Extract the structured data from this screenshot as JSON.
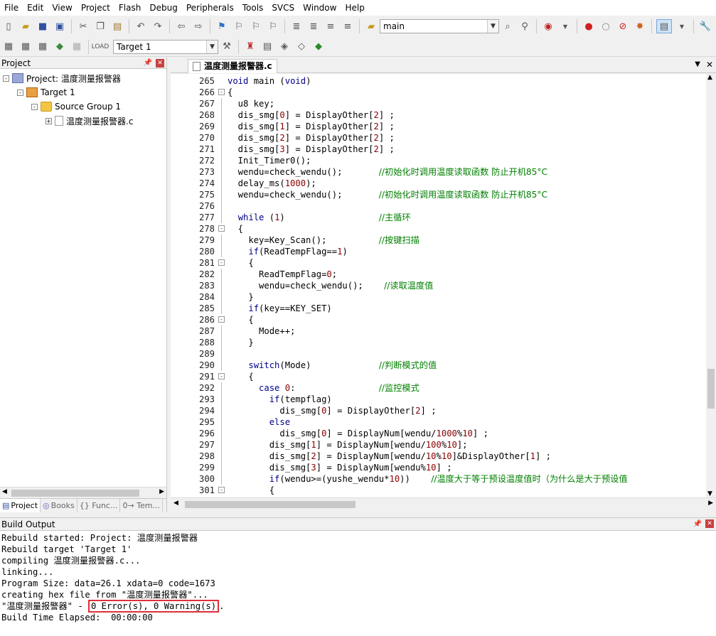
{
  "menu": [
    "File",
    "Edit",
    "View",
    "Project",
    "Flash",
    "Debug",
    "Peripherals",
    "Tools",
    "SVCS",
    "Window",
    "Help"
  ],
  "toolbar": {
    "find_combo_value": "main",
    "target_combo_value": "Target 1"
  },
  "project_panel": {
    "title": "Project",
    "tree": [
      {
        "label": "Project: 温度测量报警器",
        "toggle": "-"
      },
      {
        "label": "Target 1",
        "toggle": "-"
      },
      {
        "label": "Source Group 1",
        "toggle": "-"
      },
      {
        "label": "温度测量报警器.c",
        "toggle": "+"
      }
    ],
    "tabs": [
      "Project",
      "Books",
      "{} Func...",
      "0→ Tem..."
    ]
  },
  "editor": {
    "tab_label": "温度测量报警器.c",
    "lines": [
      {
        "n": "265",
        "fold": "",
        "code": "void main (void)"
      },
      {
        "n": "266",
        "fold": "-",
        "code": "{"
      },
      {
        "n": "267",
        "fold": "|",
        "code": "  u8 key;"
      },
      {
        "n": "268",
        "fold": "|",
        "code": "  dis_smg[0] = DisplayOther[2] ;"
      },
      {
        "n": "269",
        "fold": "|",
        "code": "  dis_smg[1] = DisplayOther[2] ;"
      },
      {
        "n": "270",
        "fold": "|",
        "code": "  dis_smg[2] = DisplayOther[2] ;"
      },
      {
        "n": "271",
        "fold": "|",
        "code": "  dis_smg[3] = DisplayOther[2] ;"
      },
      {
        "n": "272",
        "fold": "|",
        "code": "  Init_Timer0();"
      },
      {
        "n": "273",
        "fold": "|",
        "code": "  wendu=check_wendu();       //初始化时调用温度读取函数 防止开机85°C"
      },
      {
        "n": "274",
        "fold": "|",
        "code": "  delay_ms(1000);"
      },
      {
        "n": "275",
        "fold": "|",
        "code": "  wendu=check_wendu();       //初始化时调用温度读取函数 防止开机85°C"
      },
      {
        "n": "276",
        "fold": "|",
        "code": ""
      },
      {
        "n": "277",
        "fold": "|",
        "code": "  while (1)                  //主循环"
      },
      {
        "n": "278",
        "fold": "-",
        "code": "  {"
      },
      {
        "n": "279",
        "fold": "|",
        "code": "    key=Key_Scan();          //按键扫描"
      },
      {
        "n": "280",
        "fold": "|",
        "code": "    if(ReadTempFlag==1)"
      },
      {
        "n": "281",
        "fold": "-",
        "code": "    {"
      },
      {
        "n": "282",
        "fold": "|",
        "code": "      ReadTempFlag=0;"
      },
      {
        "n": "283",
        "fold": "|",
        "code": "      wendu=check_wendu();    //读取温度值"
      },
      {
        "n": "284",
        "fold": "|",
        "code": "    }"
      },
      {
        "n": "285",
        "fold": "|",
        "code": "    if(key==KEY_SET)"
      },
      {
        "n": "286",
        "fold": "-",
        "code": "    {"
      },
      {
        "n": "287",
        "fold": "|",
        "code": "      Mode++;"
      },
      {
        "n": "288",
        "fold": "|",
        "code": "    }"
      },
      {
        "n": "289",
        "fold": "|",
        "code": ""
      },
      {
        "n": "290",
        "fold": "|",
        "code": "    switch(Mode)             //判断模式的值"
      },
      {
        "n": "291",
        "fold": "-",
        "code": "    {"
      },
      {
        "n": "292",
        "fold": "|",
        "code": "      case 0:                //监控模式"
      },
      {
        "n": "293",
        "fold": "|",
        "code": "        if(tempflag)"
      },
      {
        "n": "294",
        "fold": "|",
        "code": "          dis_smg[0] = DisplayOther[2] ;"
      },
      {
        "n": "295",
        "fold": "|",
        "code": "        else"
      },
      {
        "n": "296",
        "fold": "|",
        "code": "          dis_smg[0] = DisplayNum[wendu/1000%10] ;"
      },
      {
        "n": "297",
        "fold": "|",
        "code": "        dis_smg[1] = DisplayNum[wendu/100%10];"
      },
      {
        "n": "298",
        "fold": "|",
        "code": "        dis_smg[2] = DisplayNum[wendu/10%10]&DisplayOther[1] ;"
      },
      {
        "n": "299",
        "fold": "|",
        "code": "        dis_smg[3] = DisplayNum[wendu%10] ;"
      },
      {
        "n": "300",
        "fold": "|",
        "code": "        if(wendu>=(yushe_wendu*10))    //温度大于等于预设温度值时（为什么是大于预设值"
      },
      {
        "n": "301",
        "fold": "-",
        "code": "        {"
      }
    ]
  },
  "build_output": {
    "title": "Build Output",
    "lines": [
      "Rebuild started: Project: 温度测量报警器",
      "Rebuild target 'Target 1'",
      "compiling 温度测量报警器.c...",
      "linking...",
      "Program Size: data=26.1 xdata=0 code=1673",
      "creating hex file from \"温度测量报警器\"..."
    ],
    "result_prefix": "\"温度测量报警器\" - ",
    "result_highlight": "0 Error(s), 0 Warning(s)",
    "result_suffix": ".",
    "elapsed": "Build Time Elapsed:  00:00:00"
  }
}
